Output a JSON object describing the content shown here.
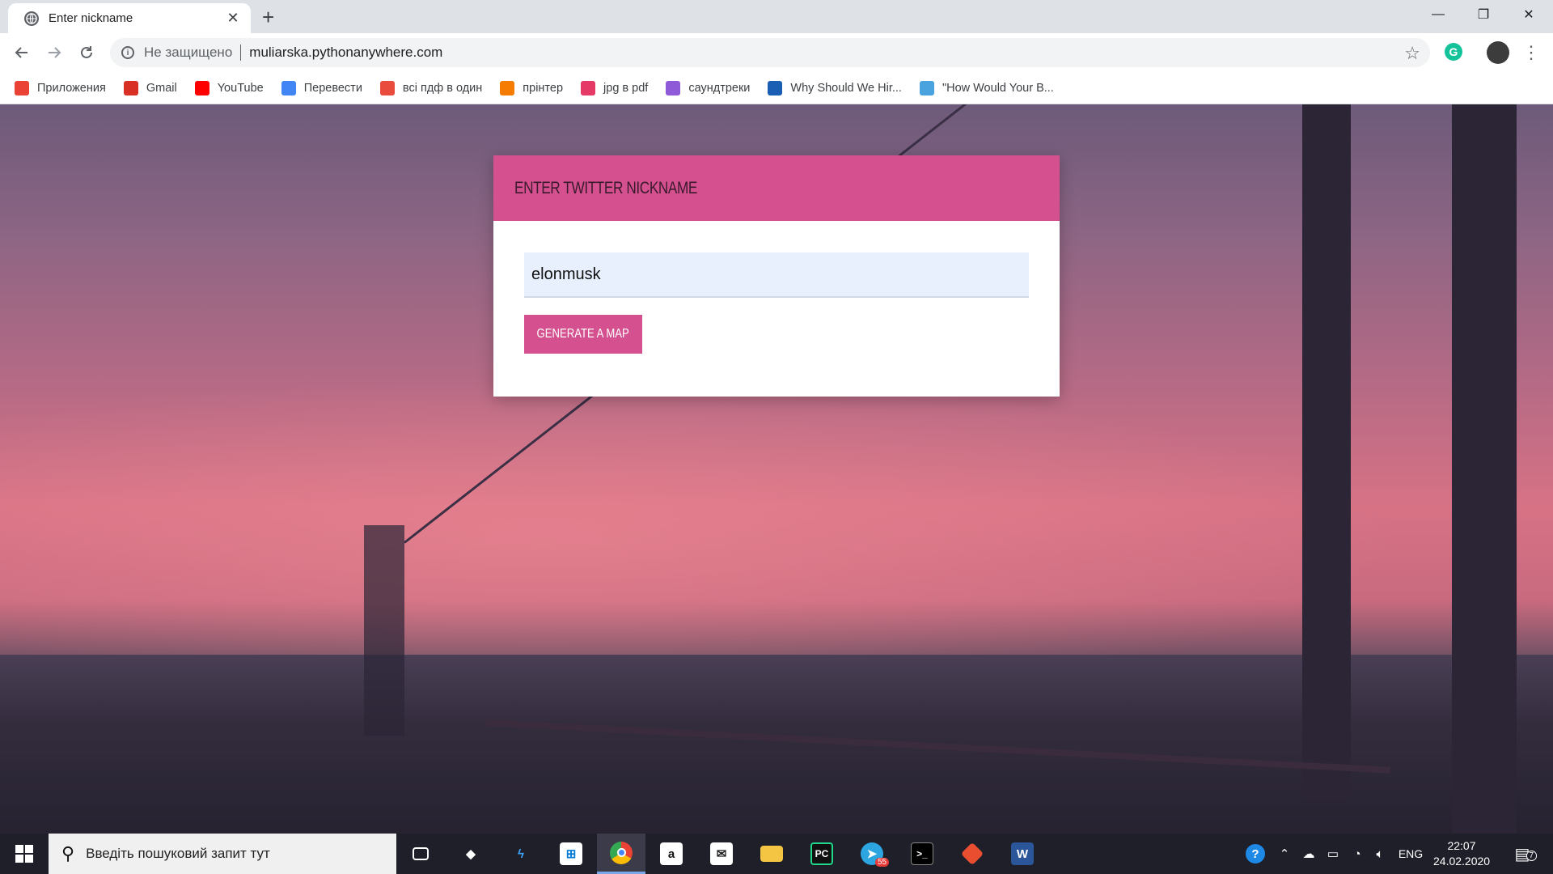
{
  "browser": {
    "tab_title": "Enter nickname",
    "tab_close": "✕",
    "new_tab": "+",
    "window_controls": {
      "minimize": "—",
      "maximize": "❐",
      "close": "✕"
    },
    "security_label": "Не защищено",
    "url": "muliarska.pythonanywhere.com",
    "extension_label": "G"
  },
  "bookmarks": [
    {
      "label": "Приложения",
      "icon": "apps-grid-icon",
      "color": "#ea4335"
    },
    {
      "label": "Gmail",
      "icon": "gmail-icon",
      "color": "#d93025"
    },
    {
      "label": "YouTube",
      "icon": "youtube-icon",
      "color": "#ff0000"
    },
    {
      "label": "Перевести",
      "icon": "translate-icon",
      "color": "#4285f4"
    },
    {
      "label": "всі пдф в один",
      "icon": "pdf-merge-icon",
      "color": "#e94b3c"
    },
    {
      "label": "прінтер",
      "icon": "link-icon",
      "color": "#f57c00"
    },
    {
      "label": "jpg в pdf",
      "icon": "jpg-pdf-icon",
      "color": "#e53966"
    },
    {
      "label": "саундтреки",
      "icon": "music-icon",
      "color": "#8e5ad8"
    },
    {
      "label": "Why Should We Hir...",
      "icon": "asterisk-icon",
      "color": "#1a5fb4"
    },
    {
      "label": "\"How Would Your B...",
      "icon": "m-circle-icon",
      "color": "#4aa3df"
    }
  ],
  "page": {
    "card_title": "ENTER TWITTER NICKNAME",
    "nickname_value": "elonmusk",
    "generate_button": "GENERATE A MAP",
    "accent_color": "#d4508f"
  },
  "taskbar": {
    "search_placeholder": "Введіть пошуковий запит тут",
    "apps": [
      "task-view",
      "dropbox",
      "visual-studio",
      "microsoft-store",
      "chrome",
      "amazon",
      "mail",
      "file-explorer",
      "pycharm",
      "telegram",
      "terminal",
      "git",
      "word"
    ],
    "telegram_badge": "55",
    "language": "ENG",
    "time": "22:07",
    "date": "24.02.2020",
    "notifications": "7"
  }
}
